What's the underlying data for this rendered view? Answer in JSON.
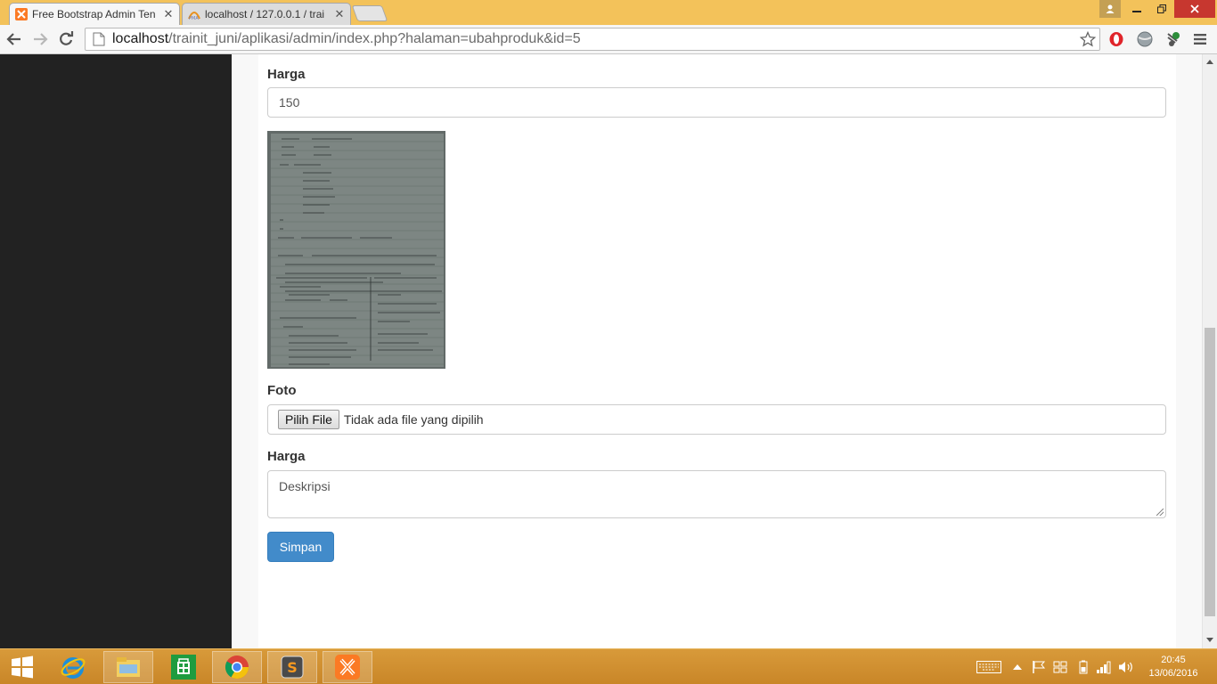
{
  "browser": {
    "tabs": [
      {
        "title": "Free Bootstrap Admin Ten",
        "active": true,
        "favicon": "xampp-icon"
      },
      {
        "title": "localhost / 127.0.0.1 / trai",
        "active": false,
        "favicon": "phpmyadmin-icon"
      }
    ],
    "url_host": "localhost",
    "url_path": "/trainit_juni/aplikasi/admin/index.php?halaman=ubahproduk&id=5"
  },
  "form": {
    "harga_label": "Harga",
    "harga_value": "150",
    "foto_label": "Foto",
    "file_button": "Pilih File",
    "file_status": "Tidak ada file yang dipilih",
    "deskripsi_label": "Harga",
    "deskripsi_placeholder": "Deskripsi",
    "submit_label": "Simpan"
  },
  "taskbar": {
    "apps": [
      "file-explorer-icon",
      "internet-explorer-icon",
      "store-icon",
      "chrome-icon",
      "sublime-text-icon",
      "xampp-icon"
    ],
    "time": "20:45",
    "date": "13/06/2016"
  },
  "colors": {
    "primary_button": "#428bca",
    "sidebar": "#222222",
    "title_bar": "#f3c25a",
    "taskbar": "#d89a3a"
  }
}
